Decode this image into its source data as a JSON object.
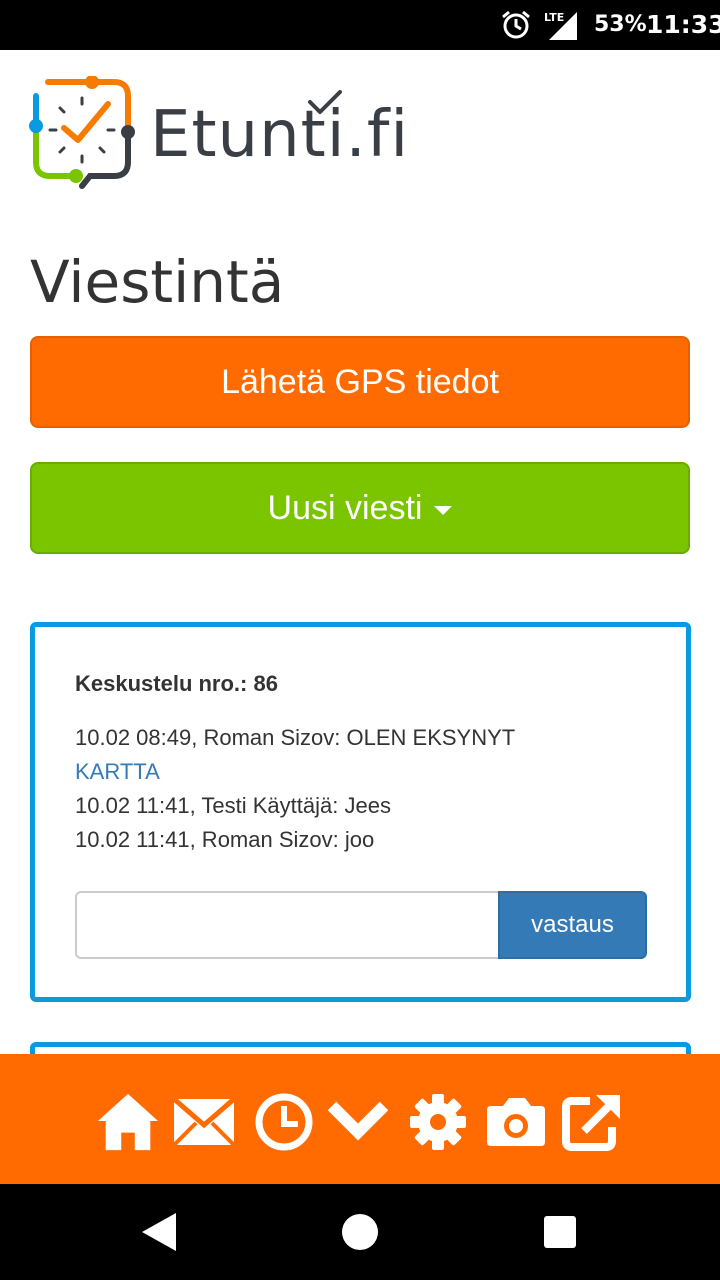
{
  "status_bar": {
    "network": "LTE",
    "battery": "53%",
    "time": "11:33"
  },
  "logo": {
    "text": "Etunti.fi"
  },
  "page": {
    "title": "Viestintä"
  },
  "buttons": {
    "send_gps": "Lähetä GPS tiedot",
    "new_message": "Uusi viesti"
  },
  "conversation": {
    "title": "Keskustelu nro.: 86",
    "messages": [
      "10.02 08:49, Roman Sizov: OLEN EKSYNYT",
      "KARTTA",
      "10.02 11:41, Testi Käyttäjä: Jees",
      "10.02 11:41, Roman Sizov: joo"
    ],
    "reply_value": "",
    "reply_button": "vastaus"
  },
  "toolbar": {
    "icons": [
      "home-icon",
      "mail-icon",
      "clock-icon",
      "chevron-down-icon",
      "gear-icon",
      "camera-icon",
      "external-link-icon"
    ]
  },
  "colors": {
    "orange": "#ff6b00",
    "green": "#7ac400",
    "blue_border": "#0a9ae0",
    "blue_button": "#337ab7"
  }
}
